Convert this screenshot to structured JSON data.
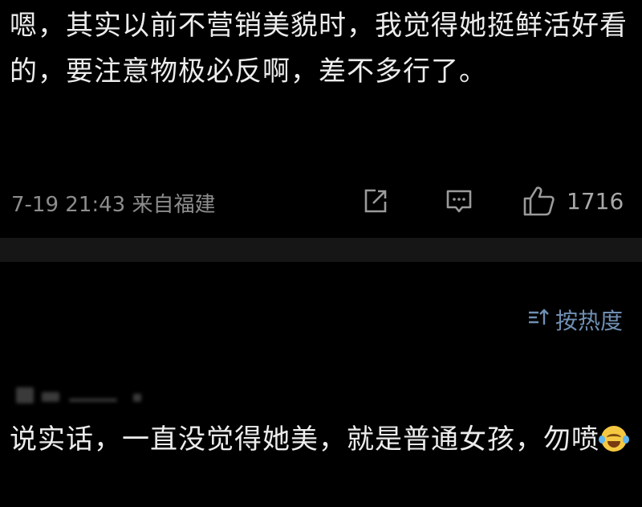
{
  "post": {
    "text": "嗯，其实以前不营销美貌时，我觉得她挺鲜活好看的，要注意物极必反啊，差不多行了。",
    "time_location": "7-19 21:43 来自福建",
    "like_count": "1716"
  },
  "icons": {
    "share": "share-icon",
    "comment": "comment-icon",
    "like": "thumbs-up-icon",
    "sort": "sort-icon",
    "emoji": "laugh-cry-emoji-icon"
  },
  "sort": {
    "label": "按热度"
  },
  "comment": {
    "text": "说实话，一直没觉得她美，就是普通女孩，勿喷"
  },
  "colors": {
    "background": "#000000",
    "text": "#ececec",
    "meta": "#8d8d8d",
    "accent": "#6f8fb3",
    "divider": "#161616"
  }
}
